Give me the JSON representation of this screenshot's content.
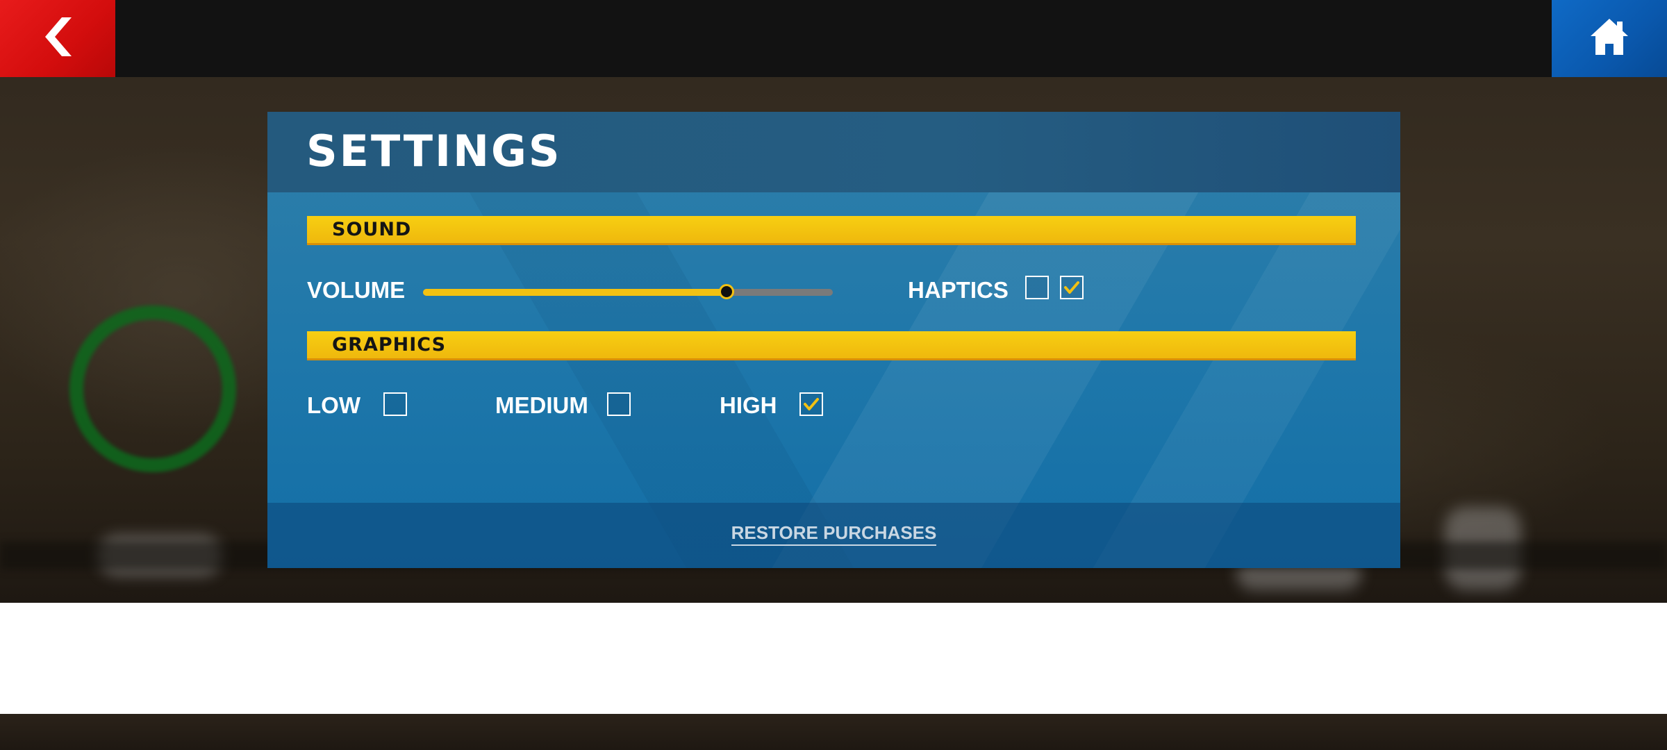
{
  "panel": {
    "title": "SETTINGS"
  },
  "sound": {
    "section_label": "SOUND",
    "volume_label": "VOLUME",
    "volume_level": 0.74,
    "haptics_label": "HAPTICS",
    "haptics_checkboxes": [
      false,
      true
    ]
  },
  "graphics": {
    "section_label": "GRAPHICS",
    "options": [
      {
        "label": "LOW",
        "checked": false
      },
      {
        "label": "MEDIUM",
        "checked": false
      },
      {
        "label": "HIGH",
        "checked": true
      }
    ]
  },
  "footer": {
    "restore_label": "RESTORE PURCHASES"
  },
  "colors": {
    "accent_yellow": "#f2c112",
    "back_red": "#d30d0d",
    "home_blue": "#0a58ad",
    "panel_blue": "#1e77aa"
  },
  "icons": {
    "back": "chevron-left-icon",
    "home": "home-icon",
    "check": "checkmark-icon"
  }
}
